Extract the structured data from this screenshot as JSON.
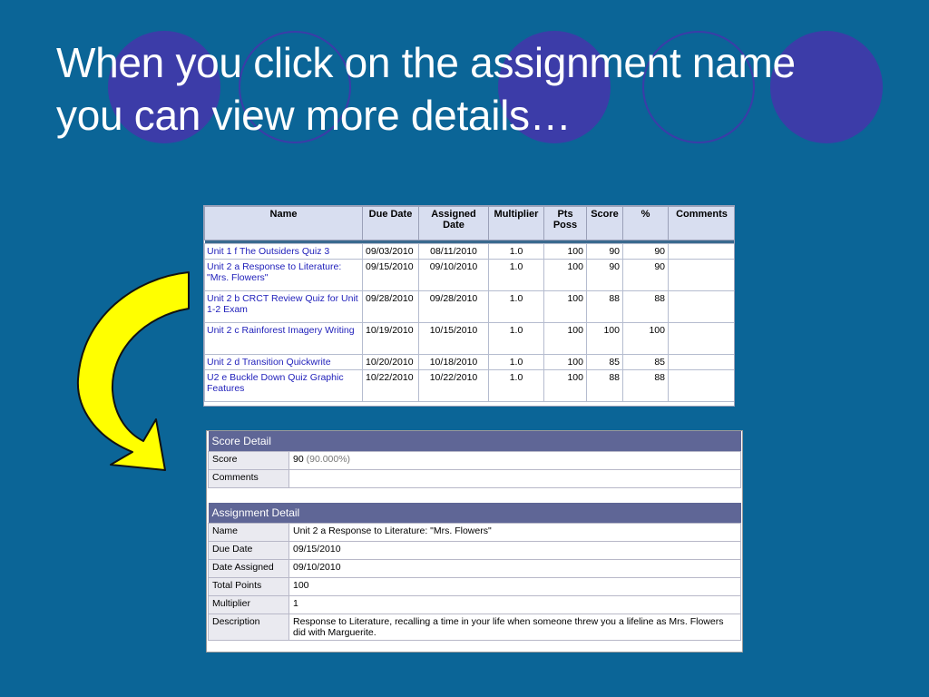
{
  "slide": {
    "title_line1": "When you click on the assignment name",
    "title_line2": "you can view more details…"
  },
  "colors": {
    "background": "#0b6597",
    "circle": "#3c3ca8",
    "arrow_fill": "#ffff00",
    "header_bar": "#5f6696",
    "link": "#2222bb"
  },
  "grades_table": {
    "headers": {
      "name": "Name",
      "due_date": "Due Date",
      "assigned_date_1": "Assigned",
      "assigned_date_2": "Date",
      "multiplier": "Multiplier",
      "pts_poss_1": "Pts",
      "pts_poss_2": "Poss",
      "score": "Score",
      "percent": "%",
      "comments": "Comments"
    },
    "rows": [
      {
        "name": "Unit 1 f The Outsiders Quiz 3",
        "due": "09/03/2010",
        "assigned": "08/11/2010",
        "multiplier": "1.0",
        "pts": "100",
        "score": "90",
        "percent": "90",
        "comments": ""
      },
      {
        "name": "Unit 2 a Response to Literature: \"Mrs. Flowers\"",
        "due": "09/15/2010",
        "assigned": "09/10/2010",
        "multiplier": "1.0",
        "pts": "100",
        "score": "90",
        "percent": "90",
        "comments": ""
      },
      {
        "name": "Unit 2 b CRCT Review Quiz for Unit 1-2 Exam",
        "due": "09/28/2010",
        "assigned": "09/28/2010",
        "multiplier": "1.0",
        "pts": "100",
        "score": "88",
        "percent": "88",
        "comments": ""
      },
      {
        "name": "Unit 2 c Rainforest Imagery Writing",
        "due": "10/19/2010",
        "assigned": "10/15/2010",
        "multiplier": "1.0",
        "pts": "100",
        "score": "100",
        "percent": "100",
        "comments": ""
      },
      {
        "name": "Unit 2 d Transition Quickwrite",
        "due": "10/20/2010",
        "assigned": "10/18/2010",
        "multiplier": "1.0",
        "pts": "100",
        "score": "85",
        "percent": "85",
        "comments": ""
      },
      {
        "name": "U2 e Buckle Down Quiz Graphic Features",
        "due": "10/22/2010",
        "assigned": "10/22/2010",
        "multiplier": "1.0",
        "pts": "100",
        "score": "88",
        "percent": "88",
        "comments": ""
      }
    ]
  },
  "score_detail": {
    "heading": "Score Detail",
    "score_label": "Score",
    "score_value": "90",
    "score_percent": "(90.000%)",
    "comments_label": "Comments",
    "comments_value": ""
  },
  "assignment_detail": {
    "heading": "Assignment Detail",
    "fields": [
      {
        "label": "Name",
        "value": "Unit 2 a Response to Literature: \"Mrs. Flowers\""
      },
      {
        "label": "Due Date",
        "value": "09/15/2010"
      },
      {
        "label": "Date Assigned",
        "value": "09/10/2010"
      },
      {
        "label": "Total Points",
        "value": "100"
      },
      {
        "label": "Multiplier",
        "value": "1"
      },
      {
        "label": "Description",
        "value": "Response to Literature, recalling a time in your life when someone threw you a lifeline as Mrs. Flowers did with Marguerite."
      }
    ]
  }
}
